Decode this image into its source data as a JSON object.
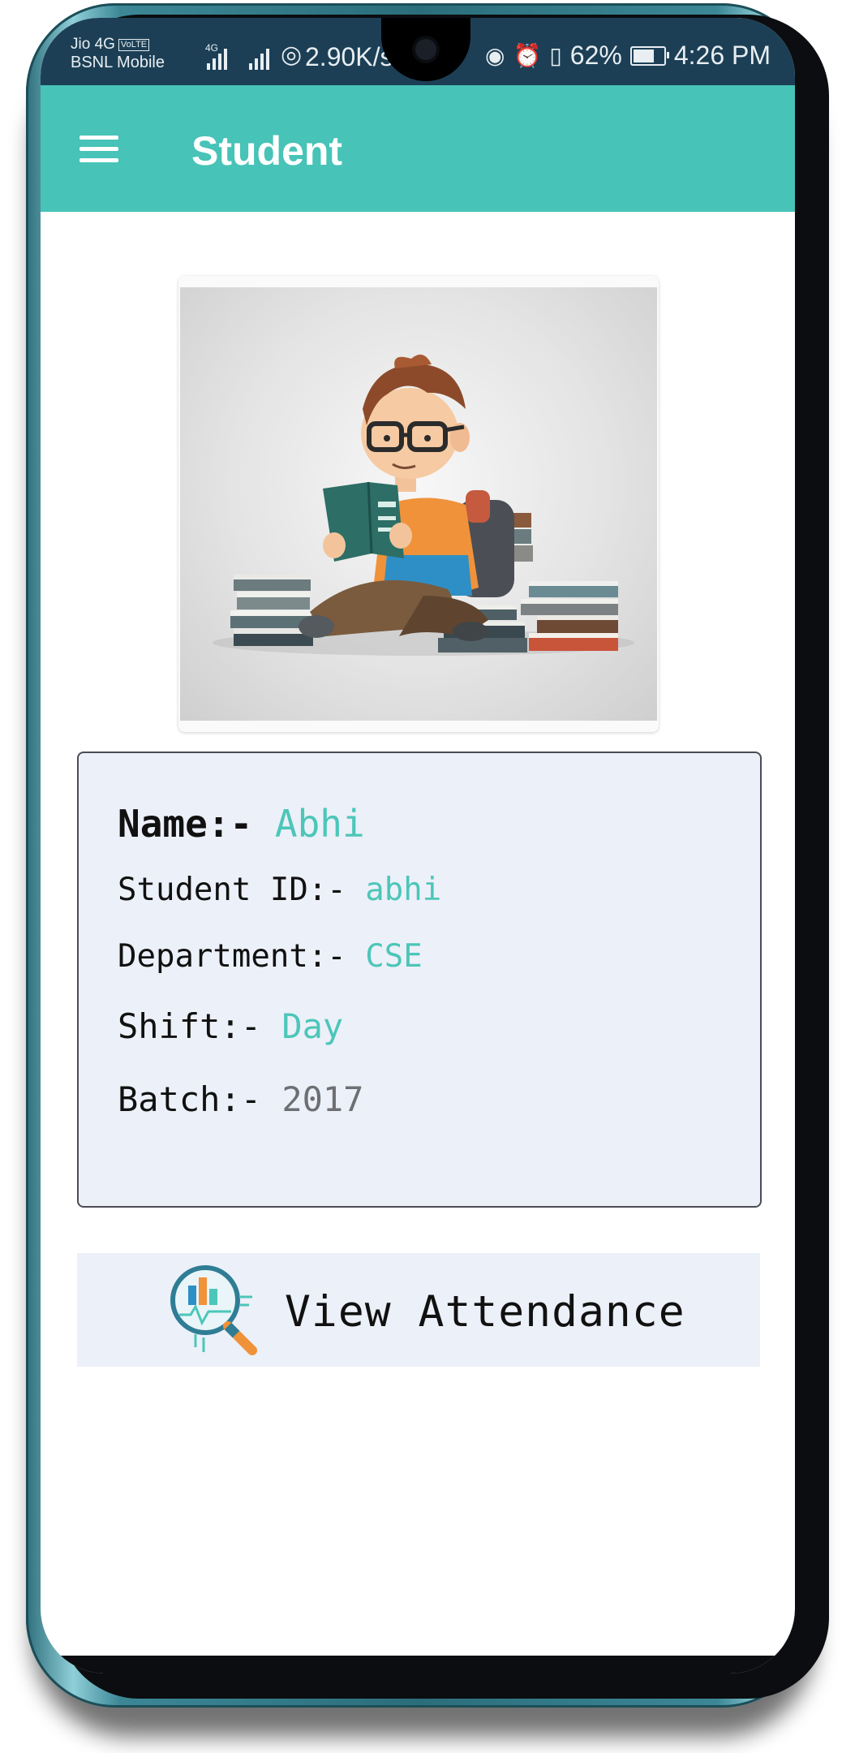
{
  "status_bar": {
    "carrier_1": "Jio 4G",
    "carrier_1_badge": "VoLTE",
    "carrier_2": "BSNL Mobile",
    "network_badge": "4G",
    "net_speed": "2.90K/s",
    "battery_percent": "62%",
    "time": "4:26 PM",
    "icons": [
      "signal-icon",
      "hotspot-icon",
      "eye-comfort-icon",
      "alarm-icon",
      "vibrate-icon",
      "battery-icon"
    ]
  },
  "app_bar": {
    "title": "Student",
    "menu_icon": "hamburger-menu-icon"
  },
  "student": {
    "name_label": "Name:-",
    "name_value": "Abhi",
    "id_label": "Student ID:-",
    "id_value": "abhi",
    "department_label": "Department:-",
    "department_value": "CSE",
    "shift_label": "Shift:-",
    "shift_value": "Day",
    "batch_label": "Batch:-",
    "batch_value": "2017"
  },
  "attendance_button": {
    "label": "View Attendance",
    "icon": "analytics-magnifier-icon"
  },
  "colors": {
    "app_bar": "#47c3b7",
    "accent_value": "#4cc6b9",
    "card_background": "#ecf0f8",
    "status_bar": "#1c3f55"
  }
}
